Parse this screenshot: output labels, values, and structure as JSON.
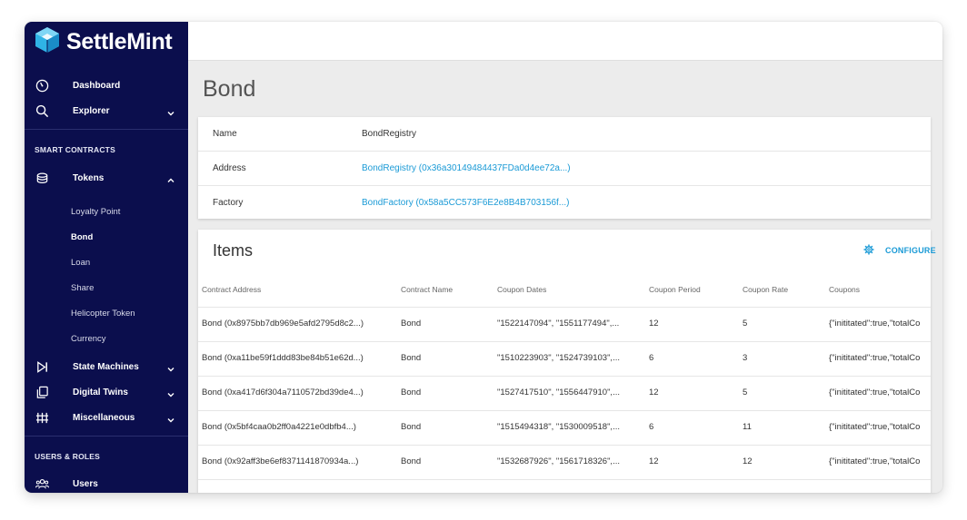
{
  "brand": {
    "name": "SettleMint",
    "accent": "#1a9ad6",
    "sidebar_bg": "#0b0e4d"
  },
  "sidebar": {
    "dashboard": {
      "label": "Dashboard",
      "icon": "gauge-icon"
    },
    "explorer": {
      "label": "Explorer",
      "icon": "search-icon"
    },
    "smart_contracts_label": "SMART CONTRACTS",
    "tokens": {
      "label": "Tokens",
      "icon": "coins-icon",
      "items": [
        "Loyalty Point",
        "Bond",
        "Loan",
        "Share",
        "Helicopter Token",
        "Currency"
      ],
      "active": "Bond"
    },
    "state_machines": {
      "label": "State Machines",
      "icon": "play-step-icon"
    },
    "digital_twins": {
      "label": "Digital Twins",
      "icon": "copy-icon"
    },
    "miscellaneous": {
      "label": "Miscellaneous",
      "icon": "fence-icon"
    },
    "users_roles_label": "USERS & ROLES",
    "users": {
      "label": "Users",
      "icon": "users-icon"
    }
  },
  "page": {
    "title": "Bond"
  },
  "details": {
    "name_label": "Name",
    "name_value": "BondRegistry",
    "address_label": "Address",
    "address_value": "BondRegistry (0x36a30149484437FDa0d4ee72a...)",
    "factory_label": "Factory",
    "factory_value": "BondFactory (0x58a5CC573F6E2e8B4B703156f...)"
  },
  "items": {
    "title": "Items",
    "configure_label": "CONFIGURE",
    "columns": [
      "Contract Address",
      "Contract Name",
      "Coupon Dates",
      "Coupon Period",
      "Coupon Rate",
      "Coupons"
    ],
    "rows": [
      {
        "address": "Bond (0x8975bb7db969e5afd2795d8c2...)",
        "name": "Bond",
        "dates": "\"1522147094\", \"1551177494\",...",
        "period": "12",
        "rate": "5",
        "coupons": "{\"inititated\":true,\"totalCo"
      },
      {
        "address": "Bond (0xa11be59f1ddd83be84b51e62d...)",
        "name": "Bond",
        "dates": "\"1510223903\", \"1524739103\",...",
        "period": "6",
        "rate": "3",
        "coupons": "{\"inititated\":true,\"totalCo"
      },
      {
        "address": "Bond (0xa417d6f304a7110572bd39de4...)",
        "name": "Bond",
        "dates": "\"1527417510\", \"1556447910\",...",
        "period": "12",
        "rate": "5",
        "coupons": "{\"inititated\":true,\"totalCo"
      },
      {
        "address": "Bond (0x5bf4caa0b2ff0a4221e0dbfb4...)",
        "name": "Bond",
        "dates": "\"1515494318\", \"1530009518\",...",
        "period": "6",
        "rate": "11",
        "coupons": "{\"inititated\":true,\"totalCo"
      },
      {
        "address": "Bond (0x92aff3be6ef8371141870934a...)",
        "name": "Bond",
        "dates": "\"1532687926\", \"1561718326\",...",
        "period": "12",
        "rate": "12",
        "coupons": "{\"inititated\":true,\"totalCo"
      }
    ]
  }
}
